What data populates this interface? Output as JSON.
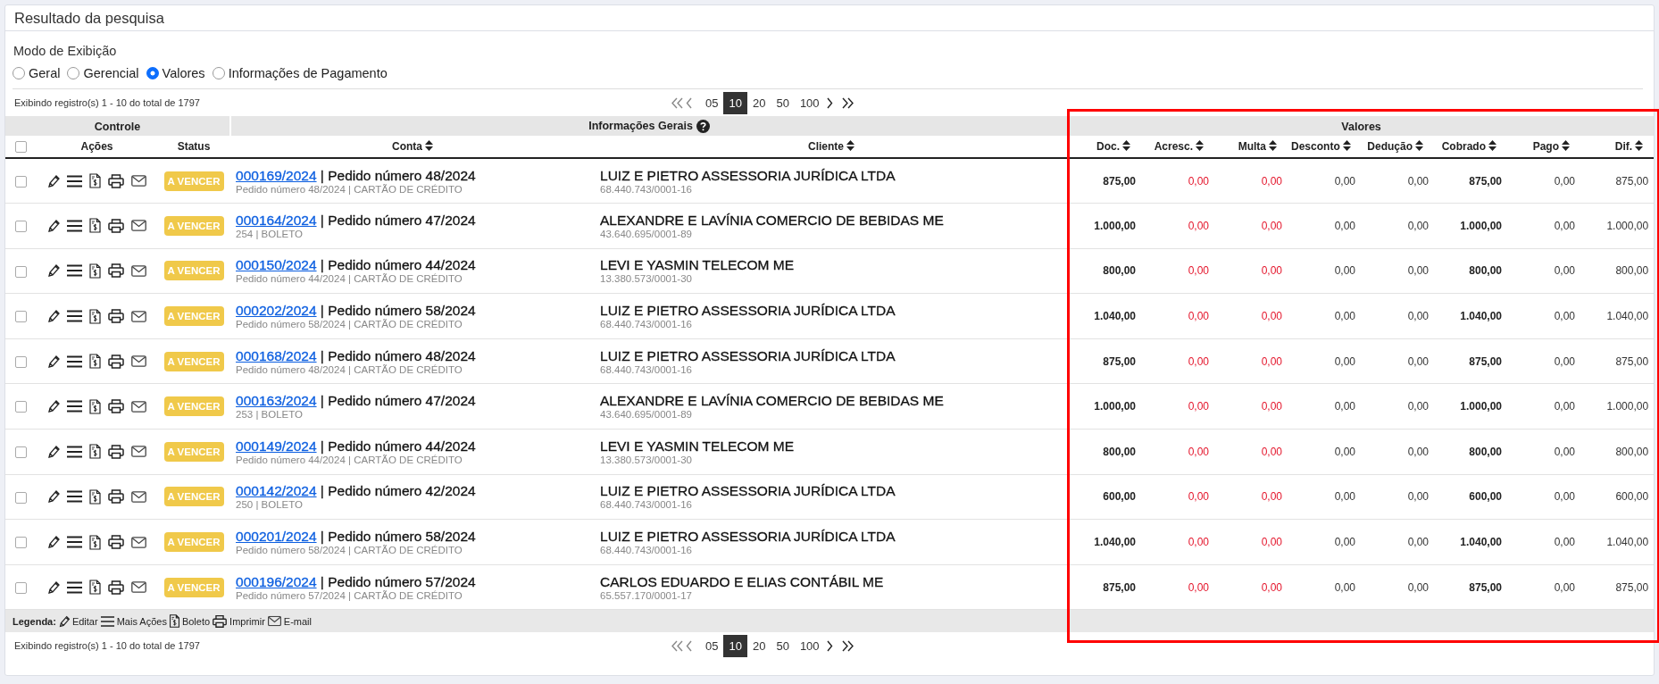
{
  "panel": {
    "title": "Resultado da pesquisa"
  },
  "display_mode": {
    "label": "Modo de Exibição",
    "options": [
      {
        "label": "Geral",
        "selected": false
      },
      {
        "label": "Gerencial",
        "selected": false
      },
      {
        "label": "Valores",
        "selected": true
      },
      {
        "label": "Informações de Pagamento",
        "selected": false
      }
    ]
  },
  "pagination_top": {
    "summary": "Exibindo registro(s) 1 - 10 do total de 1797",
    "page_sizes": [
      {
        "label": "05",
        "selected": false
      },
      {
        "label": "10",
        "selected": true
      },
      {
        "label": "20",
        "selected": false
      },
      {
        "label": "50",
        "selected": false
      },
      {
        "label": "100",
        "selected": false
      }
    ]
  },
  "table": {
    "select_all_checked": false,
    "groups": [
      {
        "label": "Controle",
        "help_icon": false
      },
      {
        "label": "Informações Gerais",
        "help_icon": true
      },
      {
        "label": "Valores",
        "help_icon": false
      }
    ],
    "columns": [
      {
        "label": "Ações",
        "sortable": false
      },
      {
        "label": "Status",
        "sortable": false
      },
      {
        "label": "Conta",
        "sortable": true
      },
      {
        "label": "Cliente",
        "sortable": true
      }
    ],
    "value_columns": [
      {
        "label": "Doc.",
        "kind": "strong"
      },
      {
        "label": "Acresc.",
        "kind": "alert"
      },
      {
        "label": "Multa",
        "kind": "alert"
      },
      {
        "label": "Desconto",
        "kind": "plain"
      },
      {
        "label": "Dedução",
        "kind": "plain"
      },
      {
        "label": "Cobrado",
        "kind": "strong"
      },
      {
        "label": "Pago",
        "kind": "plain"
      },
      {
        "label": "Dif.",
        "kind": "plain"
      }
    ],
    "rows": [
      {
        "checked": false,
        "status": "A VENCER",
        "account": "000169/2024",
        "title": "| Pedido número 48/2024",
        "detail": "Pedido número 48/2024 | CARTÃO DE CRÉDITO",
        "client": "LUIZ E PIETRO ASSESSORIA JURÍDICA LTDA",
        "document": "68.440.743/0001-16",
        "values": [
          "875,00",
          "0,00",
          "0,00",
          "0,00",
          "0,00",
          "875,00",
          "0,00",
          "875,00"
        ]
      },
      {
        "checked": false,
        "status": "A VENCER",
        "account": "000164/2024",
        "title": "| Pedido número 47/2024",
        "detail": "254 | BOLETO",
        "client": "ALEXANDRE E LAVÍNIA COMERCIO DE BEBIDAS ME",
        "document": "43.640.695/0001-89",
        "values": [
          "1.000,00",
          "0,00",
          "0,00",
          "0,00",
          "0,00",
          "1.000,00",
          "0,00",
          "1.000,00"
        ]
      },
      {
        "checked": false,
        "status": "A VENCER",
        "account": "000150/2024",
        "title": "| Pedido número 44/2024",
        "detail": "Pedido número 44/2024 | CARTÃO DE CRÉDITO",
        "client": "LEVI E YASMIN TELECOM ME",
        "document": "13.380.573/0001-30",
        "values": [
          "800,00",
          "0,00",
          "0,00",
          "0,00",
          "0,00",
          "800,00",
          "0,00",
          "800,00"
        ]
      },
      {
        "checked": false,
        "status": "A VENCER",
        "account": "000202/2024",
        "title": "| Pedido número 58/2024",
        "detail": "Pedido número 58/2024 | CARTÃO DE CRÉDITO",
        "client": "LUIZ E PIETRO ASSESSORIA JURÍDICA LTDA",
        "document": "68.440.743/0001-16",
        "values": [
          "1.040,00",
          "0,00",
          "0,00",
          "0,00",
          "0,00",
          "1.040,00",
          "0,00",
          "1.040,00"
        ]
      },
      {
        "checked": false,
        "status": "A VENCER",
        "account": "000168/2024",
        "title": "| Pedido número 48/2024",
        "detail": "Pedido número 48/2024 | CARTÃO DE CRÉDITO",
        "client": "LUIZ E PIETRO ASSESSORIA JURÍDICA LTDA",
        "document": "68.440.743/0001-16",
        "values": [
          "875,00",
          "0,00",
          "0,00",
          "0,00",
          "0,00",
          "875,00",
          "0,00",
          "875,00"
        ]
      },
      {
        "checked": false,
        "status": "A VENCER",
        "account": "000163/2024",
        "title": "| Pedido número 47/2024",
        "detail": "253 | BOLETO",
        "client": "ALEXANDRE E LAVÍNIA COMERCIO DE BEBIDAS ME",
        "document": "43.640.695/0001-89",
        "values": [
          "1.000,00",
          "0,00",
          "0,00",
          "0,00",
          "0,00",
          "1.000,00",
          "0,00",
          "1.000,00"
        ]
      },
      {
        "checked": false,
        "status": "A VENCER",
        "account": "000149/2024",
        "title": "| Pedido número 44/2024",
        "detail": "Pedido número 44/2024 | CARTÃO DE CRÉDITO",
        "client": "LEVI E YASMIN TELECOM ME",
        "document": "13.380.573/0001-30",
        "values": [
          "800,00",
          "0,00",
          "0,00",
          "0,00",
          "0,00",
          "800,00",
          "0,00",
          "800,00"
        ]
      },
      {
        "checked": false,
        "status": "A VENCER",
        "account": "000142/2024",
        "title": "| Pedido número 42/2024",
        "detail": "250 | BOLETO",
        "client": "LUIZ E PIETRO ASSESSORIA JURÍDICA LTDA",
        "document": "68.440.743/0001-16",
        "values": [
          "600,00",
          "0,00",
          "0,00",
          "0,00",
          "0,00",
          "600,00",
          "0,00",
          "600,00"
        ]
      },
      {
        "checked": false,
        "status": "A VENCER",
        "account": "000201/2024",
        "title": "| Pedido número 58/2024",
        "detail": "Pedido número 58/2024 | CARTÃO DE CRÉDITO",
        "client": "LUIZ E PIETRO ASSESSORIA JURÍDICA LTDA",
        "document": "68.440.743/0001-16",
        "values": [
          "1.040,00",
          "0,00",
          "0,00",
          "0,00",
          "0,00",
          "1.040,00",
          "0,00",
          "1.040,00"
        ]
      },
      {
        "checked": false,
        "status": "A VENCER",
        "account": "000196/2024",
        "title": "| Pedido número 57/2024",
        "detail": "Pedido número 57/2024 | CARTÃO DE CRÉDITO",
        "client": "CARLOS EDUARDO E ELIAS CONTÁBIL ME",
        "document": "65.557.170/0001-17",
        "values": [
          "875,00",
          "0,00",
          "0,00",
          "0,00",
          "0,00",
          "875,00",
          "0,00",
          "875,00"
        ]
      }
    ]
  },
  "legend": {
    "label": "Legenda:",
    "items": [
      {
        "kind": "edit",
        "label": "Editar"
      },
      {
        "kind": "menu",
        "label": "Mais Ações"
      },
      {
        "kind": "boleto",
        "label": "Boleto"
      },
      {
        "kind": "print",
        "label": "Imprimir"
      },
      {
        "kind": "email",
        "label": "E-mail"
      }
    ]
  },
  "pagination_bottom": {
    "summary": "Exibindo registro(s) 1 - 10 do total de 1797",
    "page_sizes": [
      {
        "label": "05",
        "selected": false
      },
      {
        "label": "10",
        "selected": true
      },
      {
        "label": "20",
        "selected": false
      },
      {
        "label": "50",
        "selected": false
      },
      {
        "label": "100",
        "selected": false
      }
    ]
  }
}
